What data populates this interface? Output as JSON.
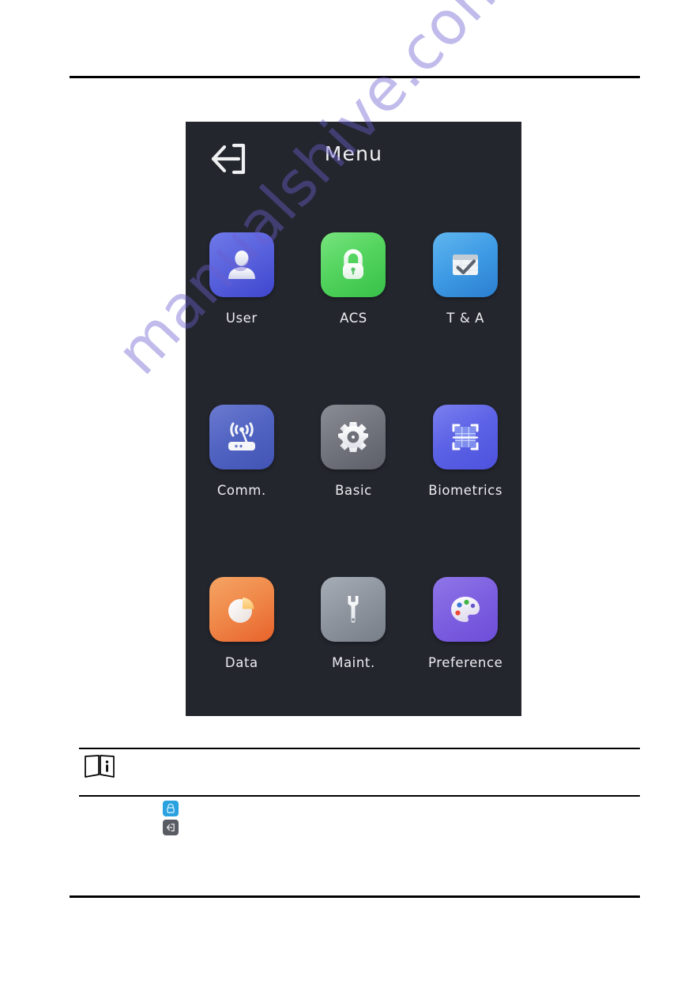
{
  "page": {
    "watermark": "manualshive.com"
  },
  "device": {
    "screen_title": "Menu",
    "back_icon": "exit-arrow-icon",
    "background_color": "#24262e",
    "menu_items": [
      {
        "label": "User",
        "icon": "user-avatar-icon",
        "color": "#5a63dd"
      },
      {
        "label": "ACS",
        "icon": "padlock-icon",
        "color": "#54d45f"
      },
      {
        "label": "T & A",
        "icon": "calendar-check-icon",
        "color": "#3e9ae4"
      },
      {
        "label": "Comm.",
        "icon": "wifi-router-icon",
        "color": "#5365c3"
      },
      {
        "label": "Basic",
        "icon": "gear-icon",
        "color": "#72747d"
      },
      {
        "label": "Biometrics",
        "icon": "scan-frame-icon",
        "color": "#5d63e6"
      },
      {
        "label": "Data",
        "icon": "pie-chart-icon",
        "color": "#ef8748"
      },
      {
        "label": "Maint.",
        "icon": "wrench-icon",
        "color": "#8e949e"
      },
      {
        "label": "Preference",
        "icon": "paint-palette-icon",
        "color": "#7c5fe0"
      }
    ]
  },
  "note": {
    "icon": "note-info-icon",
    "text": ""
  },
  "inline_icons": [
    {
      "name": "lock-badge-icon",
      "color": "#2aa2e0"
    },
    {
      "name": "back-badge-icon",
      "color": "#5a5c63"
    }
  ]
}
